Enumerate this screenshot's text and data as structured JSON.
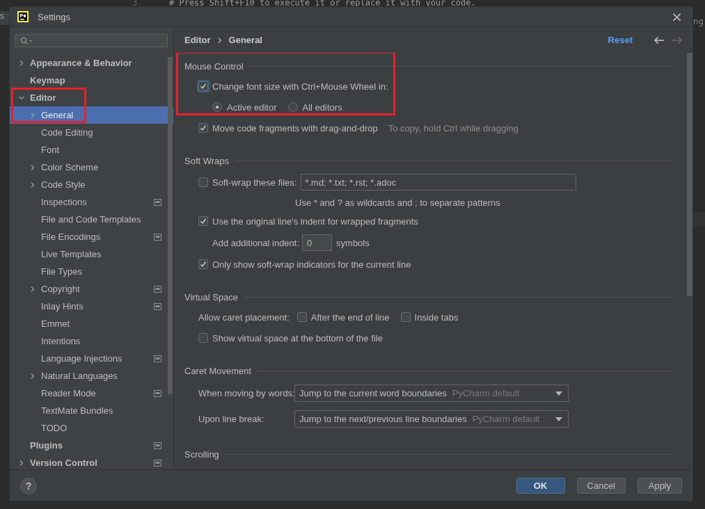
{
  "background_editor": {
    "side_tab": "s",
    "line_number": "3",
    "code_line": "# Press Shift+F10 to execute it or replace it with your code.",
    "right_text": "ng"
  },
  "window": {
    "title": "Settings",
    "close": "×"
  },
  "sidebar": {
    "items": [
      {
        "label": "Appearance & Behavior",
        "bold": true,
        "expanded": false,
        "has_children": true,
        "selected": false,
        "project_level": false
      },
      {
        "label": "Keymap",
        "bold": true,
        "has_children": false,
        "selected": false,
        "project_level": false
      },
      {
        "label": "Editor",
        "bold": true,
        "expanded": true,
        "has_children": true,
        "selected": false,
        "project_level": false,
        "highlighted": true,
        "children": [
          {
            "label": "General",
            "has_children": true,
            "expanded": false,
            "selected": true,
            "project_level": false
          },
          {
            "label": "Code Editing",
            "has_children": false,
            "selected": false,
            "project_level": false
          },
          {
            "label": "Font",
            "has_children": false,
            "selected": false,
            "project_level": false
          },
          {
            "label": "Color Scheme",
            "has_children": true,
            "expanded": false,
            "selected": false,
            "project_level": false
          },
          {
            "label": "Code Style",
            "has_children": true,
            "expanded": false,
            "selected": false,
            "project_level": false
          },
          {
            "label": "Inspections",
            "has_children": false,
            "selected": false,
            "project_level": true
          },
          {
            "label": "File and Code Templates",
            "has_children": false,
            "selected": false,
            "project_level": false
          },
          {
            "label": "File Encodings",
            "has_children": false,
            "selected": false,
            "project_level": true
          },
          {
            "label": "Live Templates",
            "has_children": false,
            "selected": false,
            "project_level": false
          },
          {
            "label": "File Types",
            "has_children": false,
            "selected": false,
            "project_level": false
          },
          {
            "label": "Copyright",
            "has_children": true,
            "expanded": false,
            "selected": false,
            "project_level": true
          },
          {
            "label": "Inlay Hints",
            "has_children": false,
            "selected": false,
            "project_level": true
          },
          {
            "label": "Emmet",
            "has_children": false,
            "selected": false,
            "project_level": false
          },
          {
            "label": "Intentions",
            "has_children": false,
            "selected": false,
            "project_level": false
          },
          {
            "label": "Language Injections",
            "has_children": false,
            "selected": false,
            "project_level": true
          },
          {
            "label": "Natural Languages",
            "has_children": true,
            "expanded": false,
            "selected": false,
            "project_level": false
          },
          {
            "label": "Reader Mode",
            "has_children": false,
            "selected": false,
            "project_level": true
          },
          {
            "label": "TextMate Bundles",
            "has_children": false,
            "selected": false,
            "project_level": false
          },
          {
            "label": "TODO",
            "has_children": false,
            "selected": false,
            "project_level": false
          }
        ]
      },
      {
        "label": "Plugins",
        "bold": true,
        "has_children": false,
        "selected": false,
        "project_level": true
      },
      {
        "label": "Version Control",
        "bold": true,
        "expanded": false,
        "has_children": true,
        "selected": false,
        "project_level": true
      }
    ]
  },
  "breadcrumb": [
    "Editor",
    "General"
  ],
  "header_actions": {
    "reset": "Reset",
    "back_enabled": true,
    "forward_enabled": false
  },
  "sections": [
    {
      "title": "Mouse Control",
      "highlighted": true,
      "rows": [
        {
          "kind": "checkbox",
          "label": "Change font size with Ctrl+Mouse Wheel in:",
          "checked": true,
          "focused": true
        },
        {
          "kind": "radios",
          "options": [
            {
              "label": "Active editor",
              "selected": true
            },
            {
              "label": "All editors",
              "selected": false
            }
          ]
        },
        {
          "kind": "checkbox",
          "label": "Move code fragments with drag-and-drop",
          "checked": true,
          "hint": "To copy, hold Ctrl while dragging"
        }
      ]
    },
    {
      "title": "Soft Wraps",
      "rows": [
        {
          "kind": "checkbox-field",
          "label": "Soft-wrap these files:",
          "checked": false,
          "value": "*.md; *.txt; *.rst; *.adoc"
        },
        {
          "kind": "note",
          "text": "Use * and ? as wildcards and ; to separate patterns"
        },
        {
          "kind": "checkbox",
          "label": "Use the original line's indent for wrapped fragments",
          "checked": true
        },
        {
          "kind": "number",
          "label": "Add additional indent:",
          "value": "0",
          "unit": "symbols"
        },
        {
          "kind": "checkbox",
          "label": "Only show soft-wrap indicators for the current line",
          "checked": true
        }
      ]
    },
    {
      "title": "Virtual Space",
      "rows": [
        {
          "kind": "checkbox-group",
          "label": "Allow caret placement:",
          "options": [
            {
              "label": "After the end of line",
              "checked": false
            },
            {
              "label": "Inside tabs",
              "checked": false
            }
          ]
        },
        {
          "kind": "checkbox",
          "label": "Show virtual space at the bottom of the file",
          "checked": false
        }
      ]
    },
    {
      "title": "Caret Movement",
      "rows": [
        {
          "kind": "dropdown",
          "label": "When moving by words:",
          "value": "Jump to the current word boundaries",
          "hint": "PyCharm default"
        },
        {
          "kind": "dropdown",
          "label": "Upon line break:",
          "value": "Jump to the next/previous line boundaries",
          "hint": "PyCharm default"
        }
      ]
    },
    {
      "title": "Scrolling"
    }
  ],
  "footer": {
    "help": "?",
    "buttons": [
      {
        "label": "OK",
        "primary": true
      },
      {
        "label": "Cancel",
        "primary": false
      },
      {
        "label": "Apply",
        "primary": false
      }
    ]
  }
}
